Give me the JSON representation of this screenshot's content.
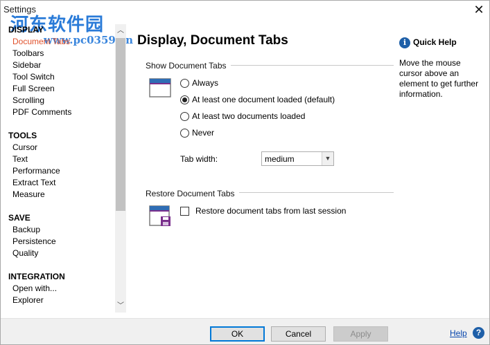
{
  "window": {
    "title": "Settings"
  },
  "watermark": {
    "chinese": "河东软件园",
    "url": "www.pc0359.cn"
  },
  "sidebar": {
    "sections": [
      {
        "heading": "DISPLAY",
        "items": [
          {
            "label": "Document Tabs",
            "active": true
          },
          {
            "label": "Toolbars"
          },
          {
            "label": "Sidebar"
          },
          {
            "label": "Tool Switch"
          },
          {
            "label": "Full Screen"
          },
          {
            "label": "Scrolling"
          },
          {
            "label": "PDF Comments"
          }
        ]
      },
      {
        "heading": "TOOLS",
        "items": [
          {
            "label": "Cursor"
          },
          {
            "label": "Text"
          },
          {
            "label": "Performance"
          },
          {
            "label": "Extract Text"
          },
          {
            "label": "Measure"
          }
        ]
      },
      {
        "heading": "SAVE",
        "items": [
          {
            "label": "Backup"
          },
          {
            "label": "Persistence"
          },
          {
            "label": "Quality"
          }
        ]
      },
      {
        "heading": "INTEGRATION",
        "items": [
          {
            "label": "Open with..."
          },
          {
            "label": "Explorer"
          }
        ]
      }
    ]
  },
  "main": {
    "title": "Display, Document Tabs",
    "show_tabs": {
      "heading": "Show Document Tabs",
      "options": [
        {
          "label": "Always",
          "checked": false
        },
        {
          "label": "At least one document loaded (default)",
          "checked": true
        },
        {
          "label": "At least two documents loaded",
          "checked": false
        },
        {
          "label": "Never",
          "checked": false
        }
      ],
      "tab_width_label": "Tab width:",
      "tab_width_value": "medium"
    },
    "restore_tabs": {
      "heading": "Restore Document Tabs",
      "checkbox_label": "Restore document tabs from last session",
      "checked": false
    }
  },
  "quick_help": {
    "title": "Quick Help",
    "text": "Move the mouse cursor above an element to get further information."
  },
  "footer": {
    "ok": "OK",
    "cancel": "Cancel",
    "apply": "Apply",
    "help": "Help"
  },
  "colors": {
    "active_item": "#e0502a",
    "accent_blue": "#1e5fa8",
    "icon_purple": "#7a2f8c",
    "icon_blue": "#2f6db5"
  },
  "icons": [
    "close-icon",
    "chevron-up-icon",
    "chevron-down-icon",
    "tab-window-icon",
    "tab-save-icon",
    "info-icon",
    "help-icon"
  ]
}
